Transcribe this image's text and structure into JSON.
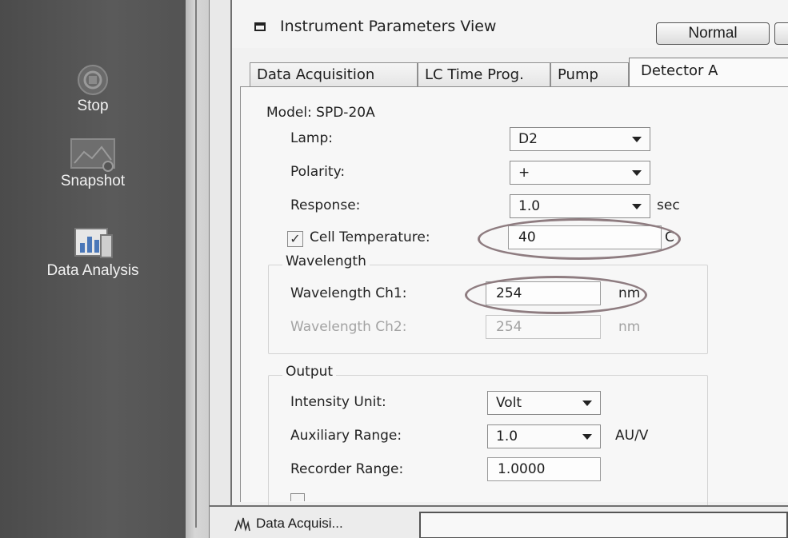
{
  "sidebar": {
    "items": [
      {
        "label": "Stop",
        "icon": "stop-icon"
      },
      {
        "label": "Snapshot",
        "icon": "snapshot-icon"
      },
      {
        "label": "Data Analysis",
        "icon": "data-analysis-icon"
      }
    ]
  },
  "window": {
    "title": "Instrument Parameters View",
    "mode_button": "Normal"
  },
  "tabs": [
    {
      "label": "Data Acquisition",
      "active": false
    },
    {
      "label": "LC Time Prog.",
      "active": false
    },
    {
      "label": "Pump",
      "active": false
    },
    {
      "label": "Detector A",
      "active": true
    }
  ],
  "detector": {
    "model_label": "Model: SPD-20A",
    "lamp": {
      "label": "Lamp:",
      "value": "D2"
    },
    "polarity": {
      "label": "Polarity:",
      "value": "+"
    },
    "response": {
      "label": "Response:",
      "value": "1.0",
      "unit": "sec"
    },
    "cell_temperature": {
      "label": "Cell Temperature:",
      "value": "40",
      "unit": "C",
      "checked": true
    },
    "wavelength": {
      "group_label": "Wavelength",
      "ch1": {
        "label": "Wavelength Ch1:",
        "value": "254",
        "unit": "nm"
      },
      "ch2": {
        "label": "Wavelength Ch2:",
        "value": "254",
        "unit": "nm",
        "enabled": false
      }
    },
    "output": {
      "group_label": "Output",
      "intensity_unit": {
        "label": "Intensity Unit:",
        "value": "Volt"
      },
      "auxiliary_range": {
        "label": "Auxiliary Range:",
        "value": "1.0",
        "unit": "AU/V"
      },
      "recorder_range": {
        "label": "Recorder Range:",
        "value": "1.0000"
      }
    }
  },
  "bottombar": {
    "tab_label": "Data Acquisi..."
  },
  "colors": {
    "sidebar_bg": "#535353",
    "highlight_ellipse": "#8e7c80"
  }
}
